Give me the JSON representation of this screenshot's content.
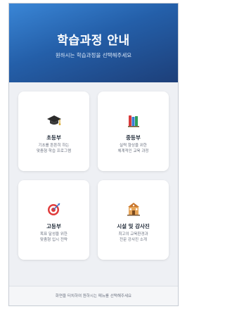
{
  "header": {
    "title": "학습과정 안내",
    "subtitle": "원하시는 학습과정을 선택해주세요"
  },
  "cards": [
    {
      "title": "초등부",
      "desc1": "기초를 튼튼히 하는",
      "desc2": "맞춤형 학습 프로그램",
      "icon": "graduation-cap-icon"
    },
    {
      "title": "중등부",
      "desc1": "실력 향상을 위한",
      "desc2": "체계적인 교육 과정",
      "icon": "books-icon"
    },
    {
      "title": "고등부",
      "desc1": "목표 달성을 위한",
      "desc2": "맞춤형 입시 전략",
      "icon": "target-icon"
    },
    {
      "title": "시설 및 강사진",
      "desc1": "최고의 교육환경과",
      "desc2": "전문 강사진 소개",
      "icon": "school-building-icon"
    }
  ],
  "footer": {
    "text": "화면을 터치하여 원하시는 메뉴를 선택해주세요"
  },
  "colors": {
    "header_top": "#3a86d6",
    "header_bottom": "#1d3f79",
    "background": "#eef0f4",
    "card": "#ffffff"
  }
}
